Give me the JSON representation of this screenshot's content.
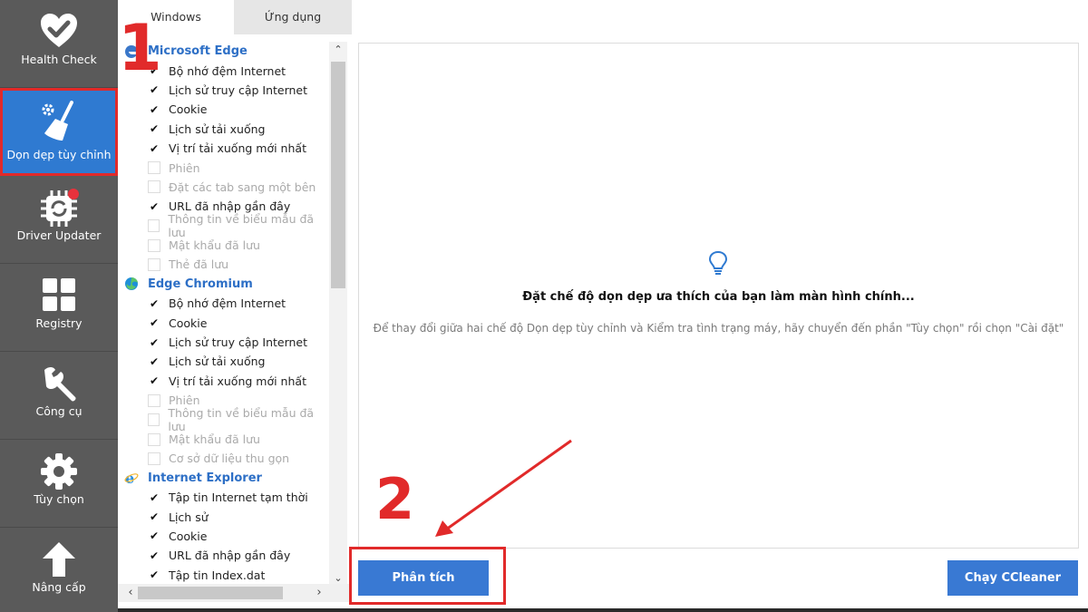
{
  "nav": {
    "items": [
      {
        "label": "Health Check",
        "icon": "heart-check-icon"
      },
      {
        "label": "Dọn dẹp tùy chỉnh",
        "icon": "broom-gear-icon"
      },
      {
        "label": "Driver Updater",
        "icon": "chip-refresh-icon"
      },
      {
        "label": "Registry",
        "icon": "grid-icon"
      },
      {
        "label": "Công cụ",
        "icon": "wrench-icon"
      },
      {
        "label": "Tùy chọn",
        "icon": "gear-icon"
      },
      {
        "label": "Nâng cấp",
        "icon": "arrow-up-icon"
      }
    ],
    "active_index": 1
  },
  "tabs": {
    "windows": "Windows",
    "apps": "Ứng dụng"
  },
  "tree": {
    "groups": [
      {
        "title": "Microsoft Edge",
        "icon": "edge-icon",
        "items": [
          {
            "label": "Bộ nhớ đệm Internet",
            "checked": true
          },
          {
            "label": "Lịch sử truy cập Internet",
            "checked": true
          },
          {
            "label": "Cookie",
            "checked": true
          },
          {
            "label": "Lịch sử tải xuống",
            "checked": true
          },
          {
            "label": "Vị trí tải xuống mới nhất",
            "checked": true
          },
          {
            "label": "Phiên",
            "checked": false
          },
          {
            "label": "Đặt các tab sang một bên",
            "checked": false
          },
          {
            "label": "URL đã nhập gần đây",
            "checked": true
          },
          {
            "label": "Thông tin về biểu mẫu đã lưu",
            "checked": false
          },
          {
            "label": "Mật khẩu đã lưu",
            "checked": false
          },
          {
            "label": "Thẻ đã lưu",
            "checked": false
          }
        ]
      },
      {
        "title": "Edge Chromium",
        "icon": "edge-chromium-icon",
        "items": [
          {
            "label": "Bộ nhớ đệm Internet",
            "checked": true
          },
          {
            "label": "Cookie",
            "checked": true
          },
          {
            "label": "Lịch sử truy cập Internet",
            "checked": true
          },
          {
            "label": "Lịch sử tải xuống",
            "checked": true
          },
          {
            "label": "Vị trí tải xuống mới nhất",
            "checked": true
          },
          {
            "label": "Phiên",
            "checked": false
          },
          {
            "label": "Thông tin về biểu mẫu đã lưu",
            "checked": false
          },
          {
            "label": "Mật khẩu đã lưu",
            "checked": false
          },
          {
            "label": "Cơ sở dữ liệu thu gọn",
            "checked": false
          }
        ]
      },
      {
        "title": "Internet Explorer",
        "icon": "internet-explorer-icon",
        "items": [
          {
            "label": "Tập tin Internet tạm thời",
            "checked": true
          },
          {
            "label": "Lịch sử",
            "checked": true
          },
          {
            "label": "Cookie",
            "checked": true
          },
          {
            "label": "URL đã nhập gần đây",
            "checked": true
          },
          {
            "label": "Tập tin Index.dat",
            "checked": true
          }
        ]
      }
    ]
  },
  "main": {
    "hint_icon": "lightbulb-icon",
    "hint_title": "Đặt chế độ dọn dẹp ưa thích của bạn làm màn hình chính...",
    "hint_text": "Để thay đổi giữa hai chế độ Dọn dẹp tùy chỉnh và Kiểm tra tình trạng máy, hãy chuyển đến phần \"Tùy chọn\" rồi chọn \"Cài đặt\"",
    "analyze_label": "Phân tích",
    "run_label": "Chạy CCleaner"
  },
  "annotations": {
    "step1": "1",
    "step2": "2"
  },
  "colors": {
    "accent": "#3979d3",
    "nav_bg": "#5a5a5a",
    "highlight": "#e12a2a",
    "group_title": "#2d6fc6"
  }
}
